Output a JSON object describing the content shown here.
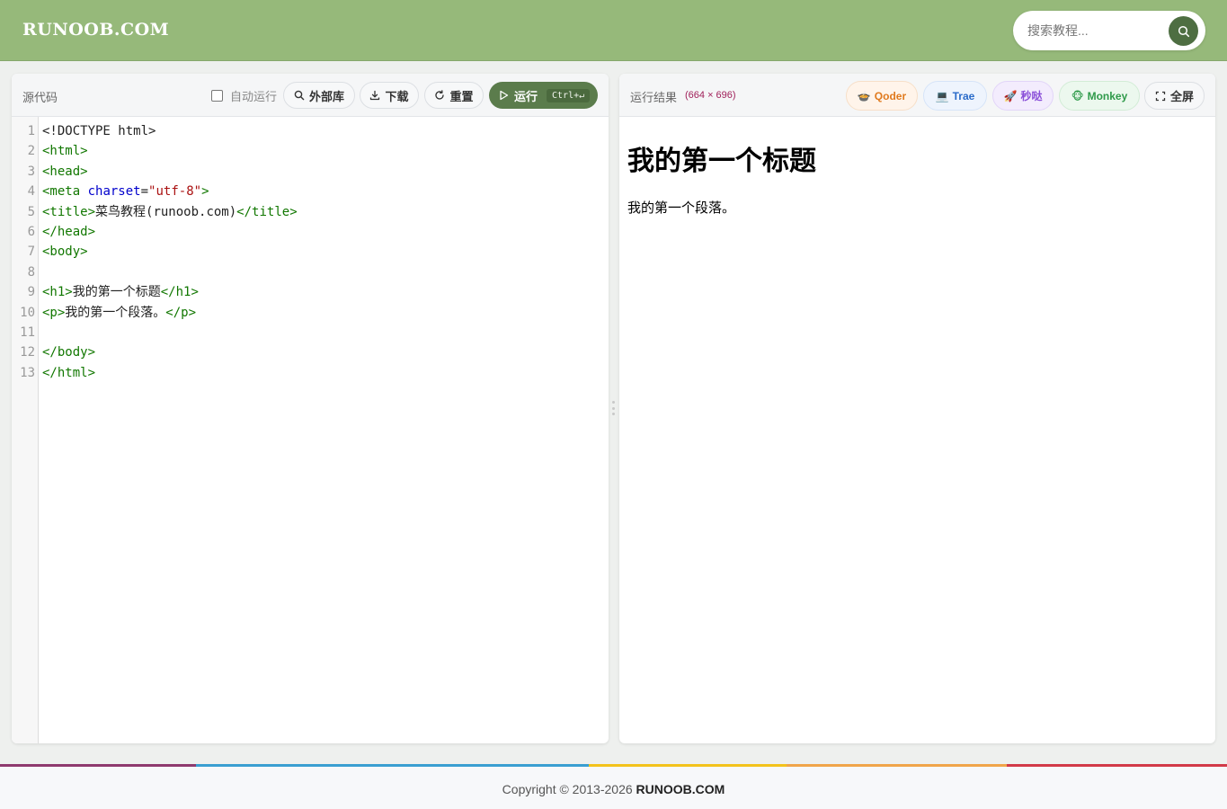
{
  "header": {
    "logo": "RUNOOB.COM",
    "search": {
      "placeholder": "搜索教程...",
      "value": ""
    },
    "search_icon": "search-icon"
  },
  "editor": {
    "title": "源代码",
    "auto_run_label": "自动运行",
    "auto_run_checked": false,
    "buttons": {
      "libs": "外部库",
      "download": "下载",
      "reset": "重置",
      "run": "运行",
      "run_shortcut": "Ctrl+↵"
    },
    "icons": {
      "libs": "search-icon",
      "download": "download-icon",
      "reset": "refresh-icon",
      "run": "play-icon"
    },
    "line_numbers": [
      "1",
      "2",
      "3",
      "4",
      "5",
      "6",
      "7",
      "8",
      "9",
      "10",
      "11",
      "12",
      "13"
    ],
    "code_lines": [
      "<!DOCTYPE html>",
      "<html>",
      "<head>",
      "<meta charset=\"utf-8\">",
      "<title>菜鸟教程(runoob.com)</title>",
      "</head>",
      "<body>",
      "",
      "<h1>我的第一个标题</h1>",
      "<p>我的第一个段落。</p>",
      "",
      "</body>",
      "</html>"
    ]
  },
  "preview": {
    "title": "运行结果",
    "dimensions": "(664 × 696)",
    "ai_buttons": {
      "qoder": {
        "label": "Qoder",
        "icon": "🍲"
      },
      "trae": {
        "label": "Trae",
        "icon": "💻"
      },
      "miaoda": {
        "label": "秒哒",
        "icon": "🚀"
      },
      "monkey": {
        "label": "Monkey",
        "icon": "🐵"
      }
    },
    "fullscreen_label": "全屏",
    "fullscreen_icon": "fullscreen-icon",
    "content": {
      "heading": "我的第一个标题",
      "paragraph": "我的第一个段落。"
    }
  },
  "footer": {
    "copyright": "Copyright © 2013-2026 ",
    "brand": "RUNOOB.COM"
  },
  "colors": {
    "header_bg": "#96b97a",
    "run_button": "#5b7c4c",
    "tag_color": "#117700",
    "attr_color": "#0000cc",
    "string_color": "#aa1111",
    "rainbow": [
      "#8e3a6e",
      "#3a9fd1",
      "#f3c31b",
      "#f0a54a",
      "#d23a48"
    ]
  }
}
